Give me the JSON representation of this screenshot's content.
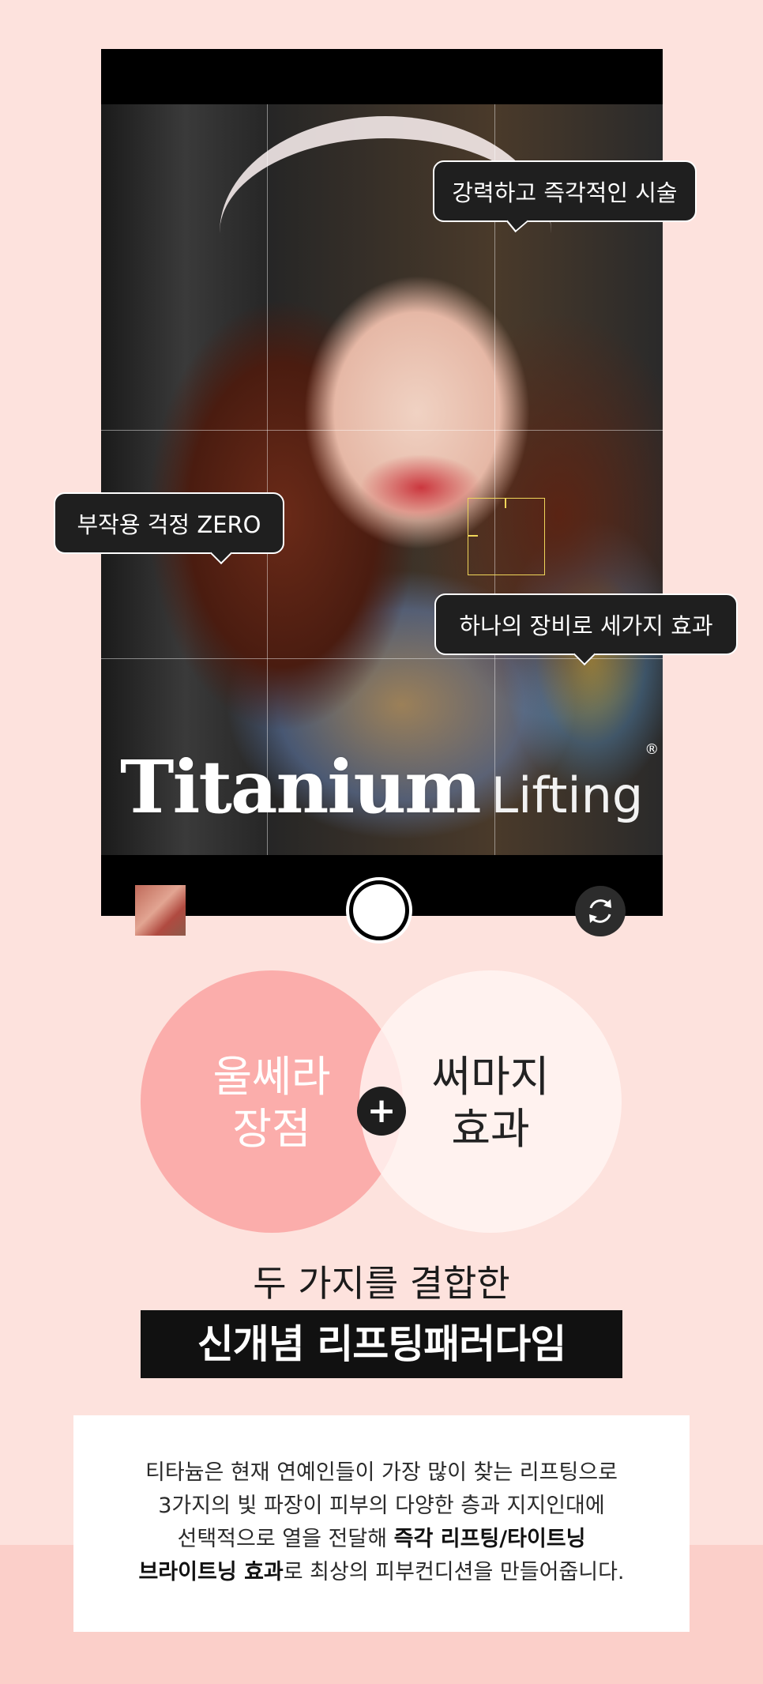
{
  "phone": {
    "logo_main": "Titanium",
    "logo_sub": "Lifting",
    "logo_reg": "®"
  },
  "bubbles": [
    "강력하고 즉각적인 시술",
    "부작용 걱정 ZERO",
    "하나의 장비로 세가지 효과"
  ],
  "venn": {
    "left_line1": "울쎄라",
    "left_line2": "장점",
    "right_line1": "써마지",
    "right_line2": "효과",
    "plus": "+"
  },
  "headline": "두 가지를 결합한",
  "banner": "신개념 리프팅패러다임",
  "description": {
    "line1": "티타늄은 현재 연예인들이 가장 많이 찾는 리프팅으로",
    "line2": "3가지의 빛 파장이 피부의 다양한 층과 지지인대에",
    "line3_a": "선택적으로 열을 전달해 ",
    "line3_b": "즉각 리프팅/타이트닝",
    "line4_a": "브라이트닝 효과",
    "line4_b": "로 최상의 피부컨디션을 만들어줍니다."
  },
  "colors": {
    "page_bg": "#fde2dd",
    "circle_left": "#fbadab",
    "circle_right": "#fff5f3",
    "focus": "#f0d65a"
  }
}
